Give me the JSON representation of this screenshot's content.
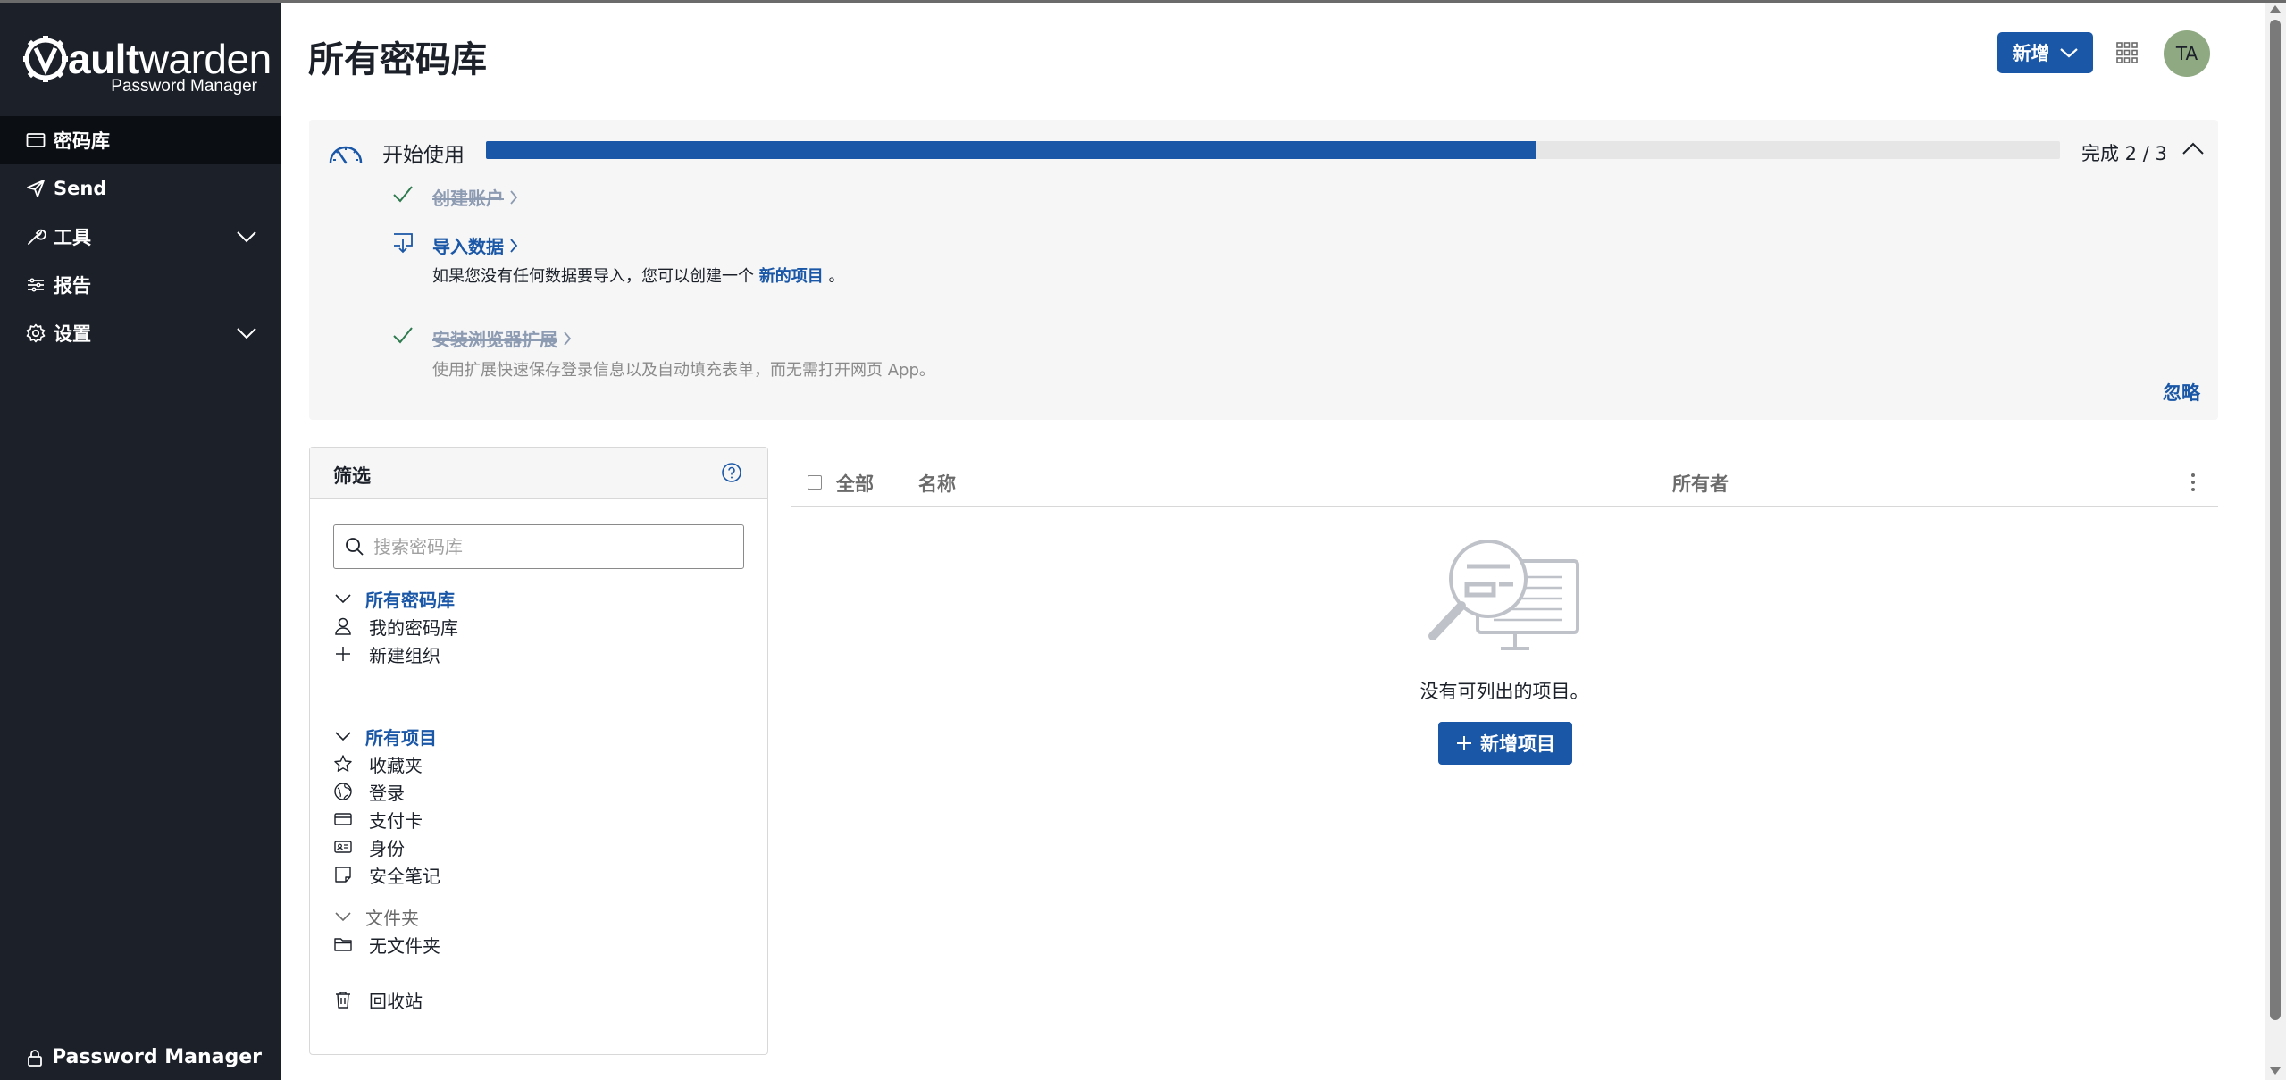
{
  "brand": {
    "logo_letters": "ault",
    "logo_rest": "warden",
    "logo_sub": "Password Manager"
  },
  "sidebar": {
    "items": [
      {
        "label": "密码库",
        "icon": "vault-icon",
        "active": true
      },
      {
        "label": "Send",
        "icon": "send-icon",
        "active": false
      },
      {
        "label": "工具",
        "icon": "tools-icon",
        "expandable": true
      },
      {
        "label": "报告",
        "icon": "reports-icon",
        "active": false
      },
      {
        "label": "设置",
        "icon": "gear-icon",
        "expandable": true
      }
    ],
    "footer": {
      "label": "Password Manager",
      "icon": "lock-icon"
    }
  },
  "header": {
    "title": "所有密码库",
    "new_button": "新增",
    "avatar_initials": "TA"
  },
  "getting_started": {
    "title": "开始使用",
    "progress": 0.667,
    "status": "完成 2 / 3",
    "steps": [
      {
        "label": "创建账户",
        "done": true
      },
      {
        "label": "导入数据",
        "done": false,
        "desc_prefix": "如果您没有任何数据要导入，您可以创建一个 ",
        "desc_link": "新的项目",
        "desc_suffix": " 。"
      },
      {
        "label": "安装浏览器扩展",
        "done": true,
        "desc": "使用扩展快速保存登录信息以及自动填充表单，而无需打开网页 App。"
      }
    ],
    "dismiss": "忽略"
  },
  "filter": {
    "title": "筛选",
    "search_placeholder": "搜索密码库",
    "vaults_header": "所有密码库",
    "vaults": [
      {
        "label": "我的密码库",
        "icon": "user-icon"
      },
      {
        "label": "新建组织",
        "icon": "plus-icon"
      }
    ],
    "items_header": "所有项目",
    "types": [
      {
        "label": "收藏夹",
        "icon": "star-icon"
      },
      {
        "label": "登录",
        "icon": "globe-icon"
      },
      {
        "label": "支付卡",
        "icon": "credit-card-icon"
      },
      {
        "label": "身份",
        "icon": "id-card-icon"
      },
      {
        "label": "安全笔记",
        "icon": "note-icon"
      }
    ],
    "folders_header": "文件夹",
    "folders": [
      {
        "label": "无文件夹",
        "icon": "folder-icon"
      }
    ],
    "trash": {
      "label": "回收站",
      "icon": "trash-icon"
    }
  },
  "table": {
    "col_all": "全部",
    "col_name": "名称",
    "col_owner": "所有者",
    "empty_text": "没有可列出的项目。",
    "add_item_button": "新增项目"
  },
  "colors": {
    "sidebar_bg": "#1b2029",
    "primary": "#1a57a7",
    "panel_bg": "#f6f6f6",
    "avatar_bg": "#8fa982"
  }
}
